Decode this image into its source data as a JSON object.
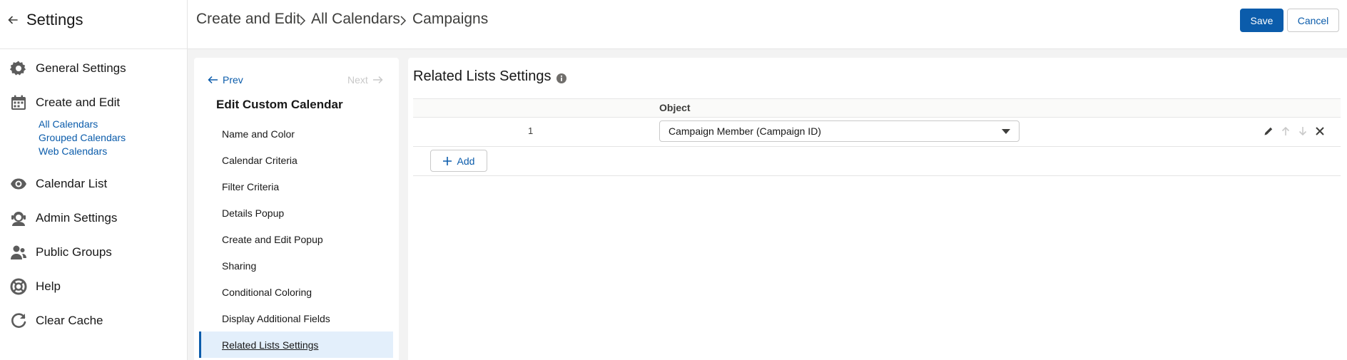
{
  "sidebar": {
    "title": "Settings",
    "items": [
      {
        "label": "General Settings",
        "icon": "gear-icon"
      },
      {
        "label": "Create and Edit",
        "icon": "calendar-icon"
      },
      {
        "label": "Calendar List",
        "icon": "eye-icon"
      },
      {
        "label": "Admin Settings",
        "icon": "admin-icon"
      },
      {
        "label": "Public Groups",
        "icon": "groups-icon"
      },
      {
        "label": "Help",
        "icon": "help-icon"
      },
      {
        "label": "Clear Cache",
        "icon": "refresh-icon"
      }
    ],
    "subitems": [
      "All Calendars",
      "Grouped Calendars",
      "Web Calendars"
    ]
  },
  "header": {
    "breadcrumbs": [
      "Create and Edit",
      "All Calendars",
      "Campaigns"
    ],
    "save_label": "Save",
    "cancel_label": "Cancel"
  },
  "wizard": {
    "prev_label": "Prev",
    "next_label": "Next",
    "title": "Edit Custom Calendar",
    "steps": [
      "Name and Color",
      "Calendar Criteria",
      "Filter Criteria",
      "Details Popup",
      "Create and Edit Popup",
      "Sharing",
      "Conditional Coloring",
      "Display Additional Fields",
      "Related Lists Settings"
    ],
    "active_step": "Related Lists Settings"
  },
  "main": {
    "title": "Related Lists Settings",
    "table": {
      "column_object": "Object",
      "rows": [
        {
          "index": "1",
          "object": "Campaign Member (Campaign ID)"
        }
      ]
    },
    "add_label": "Add"
  },
  "colors": {
    "accent": "#0b5cab",
    "active_step_bg": "#e3effb",
    "page_bg": "#f3f3f3"
  }
}
